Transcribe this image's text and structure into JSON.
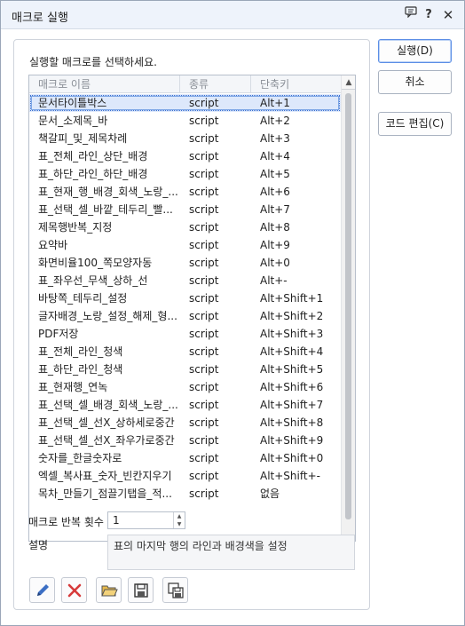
{
  "window": {
    "title": "매크로 실행",
    "titlebar_icons": [
      "message-icon",
      "help-icon",
      "close-icon"
    ],
    "help_glyph": "?",
    "close_glyph": "✕"
  },
  "prompt": "실행할 매크로를 선택하세요.",
  "table": {
    "headers": {
      "name": "매크로 이름",
      "type": "종류",
      "key": "단축키"
    },
    "selected_index": 0,
    "rows": [
      {
        "name": "문서타이틀박스",
        "type": "script",
        "key": "Alt+1"
      },
      {
        "name": "문서_소제목_바",
        "type": "script",
        "key": "Alt+2"
      },
      {
        "name": "책갈피_및_제목차례",
        "type": "script",
        "key": "Alt+3"
      },
      {
        "name": "표_전체_라인_상단_배경",
        "type": "script",
        "key": "Alt+4"
      },
      {
        "name": "표_하단_라인_하단_배경",
        "type": "script",
        "key": "Alt+5"
      },
      {
        "name": "표_현재_행_배경_회색_노랑_...",
        "type": "script",
        "key": "Alt+6"
      },
      {
        "name": "표_선택_셀_바깥_테두리_빨...",
        "type": "script",
        "key": "Alt+7"
      },
      {
        "name": "제목행반복_지정",
        "type": "script",
        "key": "Alt+8"
      },
      {
        "name": "요약바",
        "type": "script",
        "key": "Alt+9"
      },
      {
        "name": "화면비율100_쪽모양자동",
        "type": "script",
        "key": "Alt+0"
      },
      {
        "name": "표_좌우선_무색_상하_선",
        "type": "script",
        "key": "Alt+-"
      },
      {
        "name": "바탕쪽_테두리_설정",
        "type": "script",
        "key": "Alt+Shift+1"
      },
      {
        "name": "글자배경_노랑_설정_해제_형...",
        "type": "script",
        "key": "Alt+Shift+2"
      },
      {
        "name": "PDF저장",
        "type": "script",
        "key": "Alt+Shift+3"
      },
      {
        "name": "표_전체_라인_청색",
        "type": "script",
        "key": "Alt+Shift+4"
      },
      {
        "name": "표_하단_라인_청색",
        "type": "script",
        "key": "Alt+Shift+5"
      },
      {
        "name": "표_현재행_연녹",
        "type": "script",
        "key": "Alt+Shift+6"
      },
      {
        "name": "표_선택_셀_배경_회색_노랑_...",
        "type": "script",
        "key": "Alt+Shift+7"
      },
      {
        "name": "표_선택_셀_선X_상하세로중간",
        "type": "script",
        "key": "Alt+Shift+8"
      },
      {
        "name": "표_선택_셀_선X_좌우가로중간",
        "type": "script",
        "key": "Alt+Shift+9"
      },
      {
        "name": "숫자를_한글숫자로",
        "type": "script",
        "key": "Alt+Shift+0"
      },
      {
        "name": "엑셀_복사표_숫자_빈칸지우기",
        "type": "script",
        "key": "Alt+Shift+-"
      },
      {
        "name": "목차_만들기_점끌기탭을_적...",
        "type": "script",
        "key": "없음"
      }
    ]
  },
  "repeat": {
    "label": "매크로 반복 횟수",
    "value": "1"
  },
  "description": {
    "label": "설명",
    "text": "표의 마지막 행의 라인과 배경색을 설정"
  },
  "toolbar": [
    "edit-pencil-icon",
    "delete-x-icon",
    "open-folder-icon",
    "save-disk-icon",
    "save-as-disk-icon"
  ],
  "buttons": {
    "run": "실행(D)",
    "cancel": "취소",
    "edit_code": "코드 편집(C)"
  },
  "colors": {
    "accent": "#5b8ee6",
    "selection": "#dde8fb",
    "delete_red": "#d63a3a",
    "pencil_blue": "#3c6fc4"
  }
}
